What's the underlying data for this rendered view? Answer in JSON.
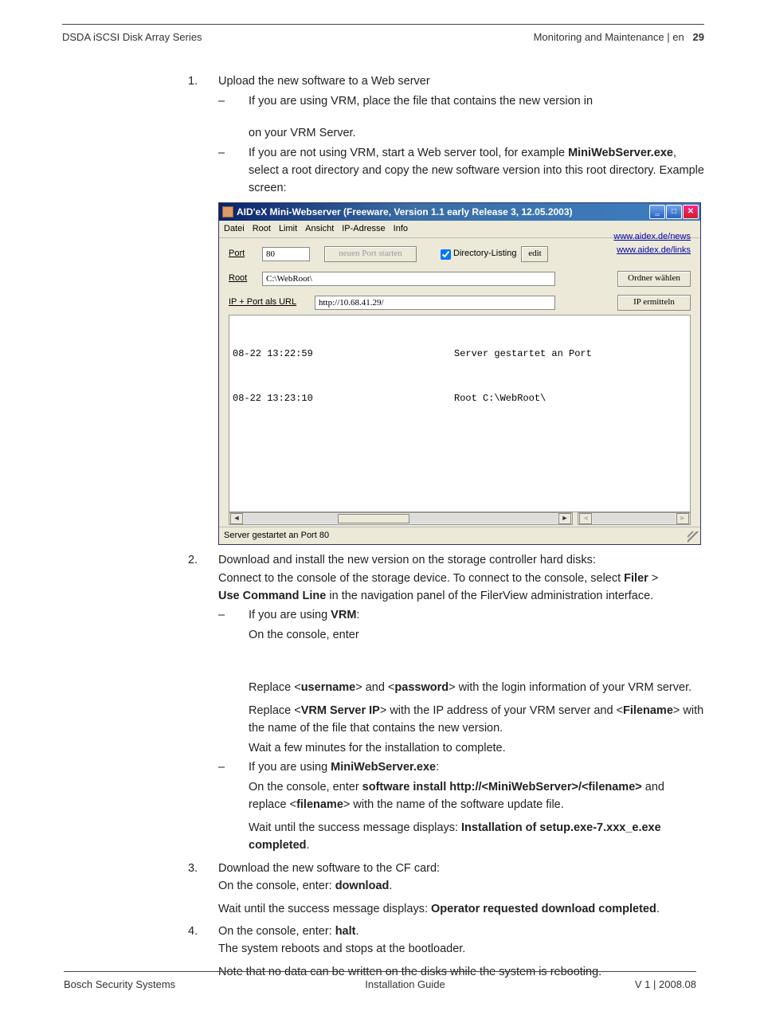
{
  "header": {
    "left": "DSDA iSCSI Disk Array Series",
    "right_text": "Monitoring and Maintenance | en",
    "page_num": "29"
  },
  "footer": {
    "left": "Bosch Security Systems",
    "center": "Installation Guide",
    "right": "V 1 | 2008.08"
  },
  "steps": {
    "s1": {
      "num": "1.",
      "text": "Upload the new software to a Web server",
      "sub1_a": "If you are using VRM, place the file that contains the new version in",
      "sub1_b": "on your VRM Server.",
      "sub2_intro": "If you are not using VRM, start a Web server tool, for example ",
      "sub2_bold": "MiniWebServer.exe",
      "sub2_tail": ", select a root directory and copy the new software version into this root directory. Example screen:"
    },
    "s2": {
      "num": "2.",
      "line1": "Download and install the new version on the storage controller hard disks:",
      "line2a": "Connect to the console of the storage device. To connect to the console, select ",
      "line2b": "Filer",
      "line2c": " > ",
      "line2d": "Use Command Line",
      "line2e": " in the navigation panel of the FilerView administration interface.",
      "vrm_head": "If you are using ",
      "vrm_bold": "VRM",
      "vrm_colon": ":",
      "vrm_enter": "On the console, enter",
      "repl1a": "Replace <",
      "repl1b": "username",
      "repl1c": "> and <",
      "repl1d": "password",
      "repl1e": "> with the login information of your VRM server.",
      "repl2a": "Replace <",
      "repl2b": "VRM Server IP",
      "repl2c": "> with the IP address of your VRM server and <",
      "repl2d": "Filename",
      "repl2e": "> with the name of the file that contains the new version.",
      "wait1": "Wait a few minutes for the installation to complete.",
      "mini_head": "If you are using ",
      "mini_bold": "MiniWebServer.exe",
      "mini_colon": ":",
      "mini_enter_a": "On the console, enter ",
      "mini_enter_b": "software install http://<MiniWebServer>/<filename>",
      "mini_enter_c": " and replace <",
      "mini_enter_d": "filename",
      "mini_enter_e": "> with the name of the software update file.",
      "mini_wait_a": "Wait until the success message displays: ",
      "mini_wait_b": "Installation of setup.exe-7.xxx_e.exe completed",
      "mini_wait_c": "."
    },
    "s3": {
      "num": "3.",
      "line1": "Download the new software to the CF card:",
      "line2a": "On the console, enter: ",
      "line2b": "download",
      "line2c": ".",
      "line3a": "Wait until the success message displays: ",
      "line3b": "Operator requested download completed",
      "line3c": "."
    },
    "s4": {
      "num": "4.",
      "line1a": "On the console, enter: ",
      "line1b": "halt",
      "line1c": ".",
      "line2": "The system reboots and stops at the bootloader.",
      "line3": "Note that no data can be written on the disks while the system is rebooting."
    }
  },
  "window": {
    "title": "AID'eX  Mini-Webserver  (Freeware, Version 1.1 early Release 3, 12.05.2003)",
    "menu": [
      "Datei",
      "Root",
      "Limit",
      "Ansicht",
      "IP-Adresse",
      "Info"
    ],
    "labels": {
      "port": "Port",
      "root": "Root",
      "url": "IP + Port als URL",
      "new_port": "neuen Port starten",
      "dirlist": "Directory-Listing",
      "edit": "edit",
      "folder": "Ordner wählen",
      "ip": "IP ermitteln"
    },
    "fields": {
      "port": "80",
      "root": "C:\\WebRoot\\",
      "url": "http://10.68.41.29/"
    },
    "links": {
      "l1": "www.aidex.de/news",
      "l2": "www.aidex.de/links"
    },
    "log": [
      {
        "time": "08-22 13:22:59",
        "msg": "Server gestartet an Port"
      },
      {
        "time": "08-22 13:23:10",
        "msg": "Root C:\\WebRoot\\"
      }
    ],
    "status": "Server gestartet an Port 80"
  }
}
